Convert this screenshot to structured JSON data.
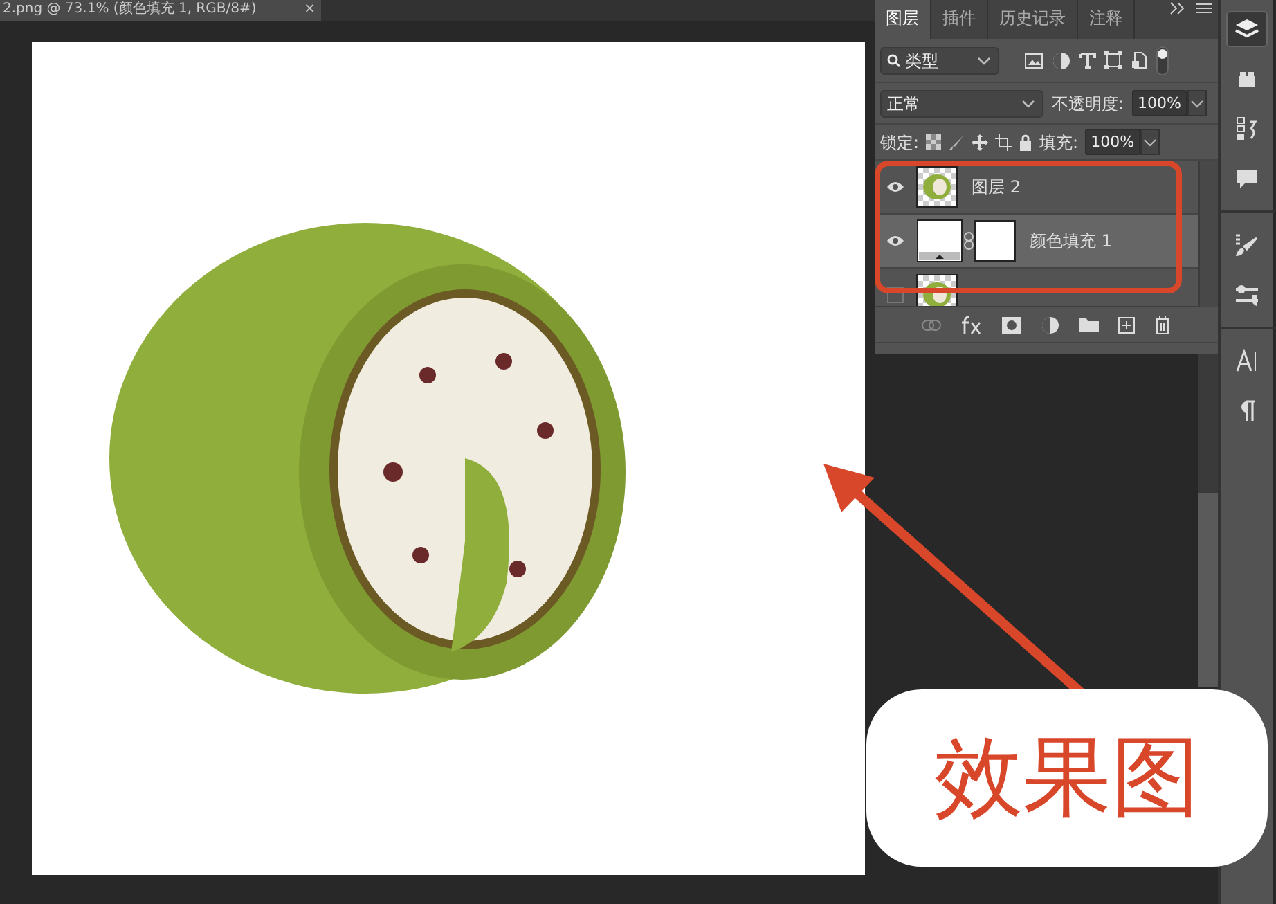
{
  "document_tab": {
    "title": "2.png @ 73.1% (颜色填充 1, RGB/8#)",
    "close": "×"
  },
  "layers_panel": {
    "tabs": [
      {
        "label": "图层",
        "selected": true
      },
      {
        "label": "插件",
        "selected": false
      },
      {
        "label": "历史记录",
        "selected": false
      },
      {
        "label": "注释",
        "selected": false
      }
    ],
    "filter": {
      "value": "类型"
    },
    "blend_mode": {
      "value": "正常"
    },
    "opacity": {
      "label": "不透明度:",
      "value": "100%"
    },
    "lock": {
      "label": "锁定:"
    },
    "fill": {
      "label": "填充:",
      "value": "100%"
    },
    "layers": [
      {
        "name": "图层 2",
        "kind": "pixel",
        "visible": true,
        "selected": false
      },
      {
        "name": "颜色填充 1",
        "kind": "fill",
        "visible": true,
        "selected": true
      },
      {
        "kind": "pixel",
        "visible": false,
        "selected": false
      }
    ]
  },
  "annotation": {
    "text": "效果图"
  }
}
